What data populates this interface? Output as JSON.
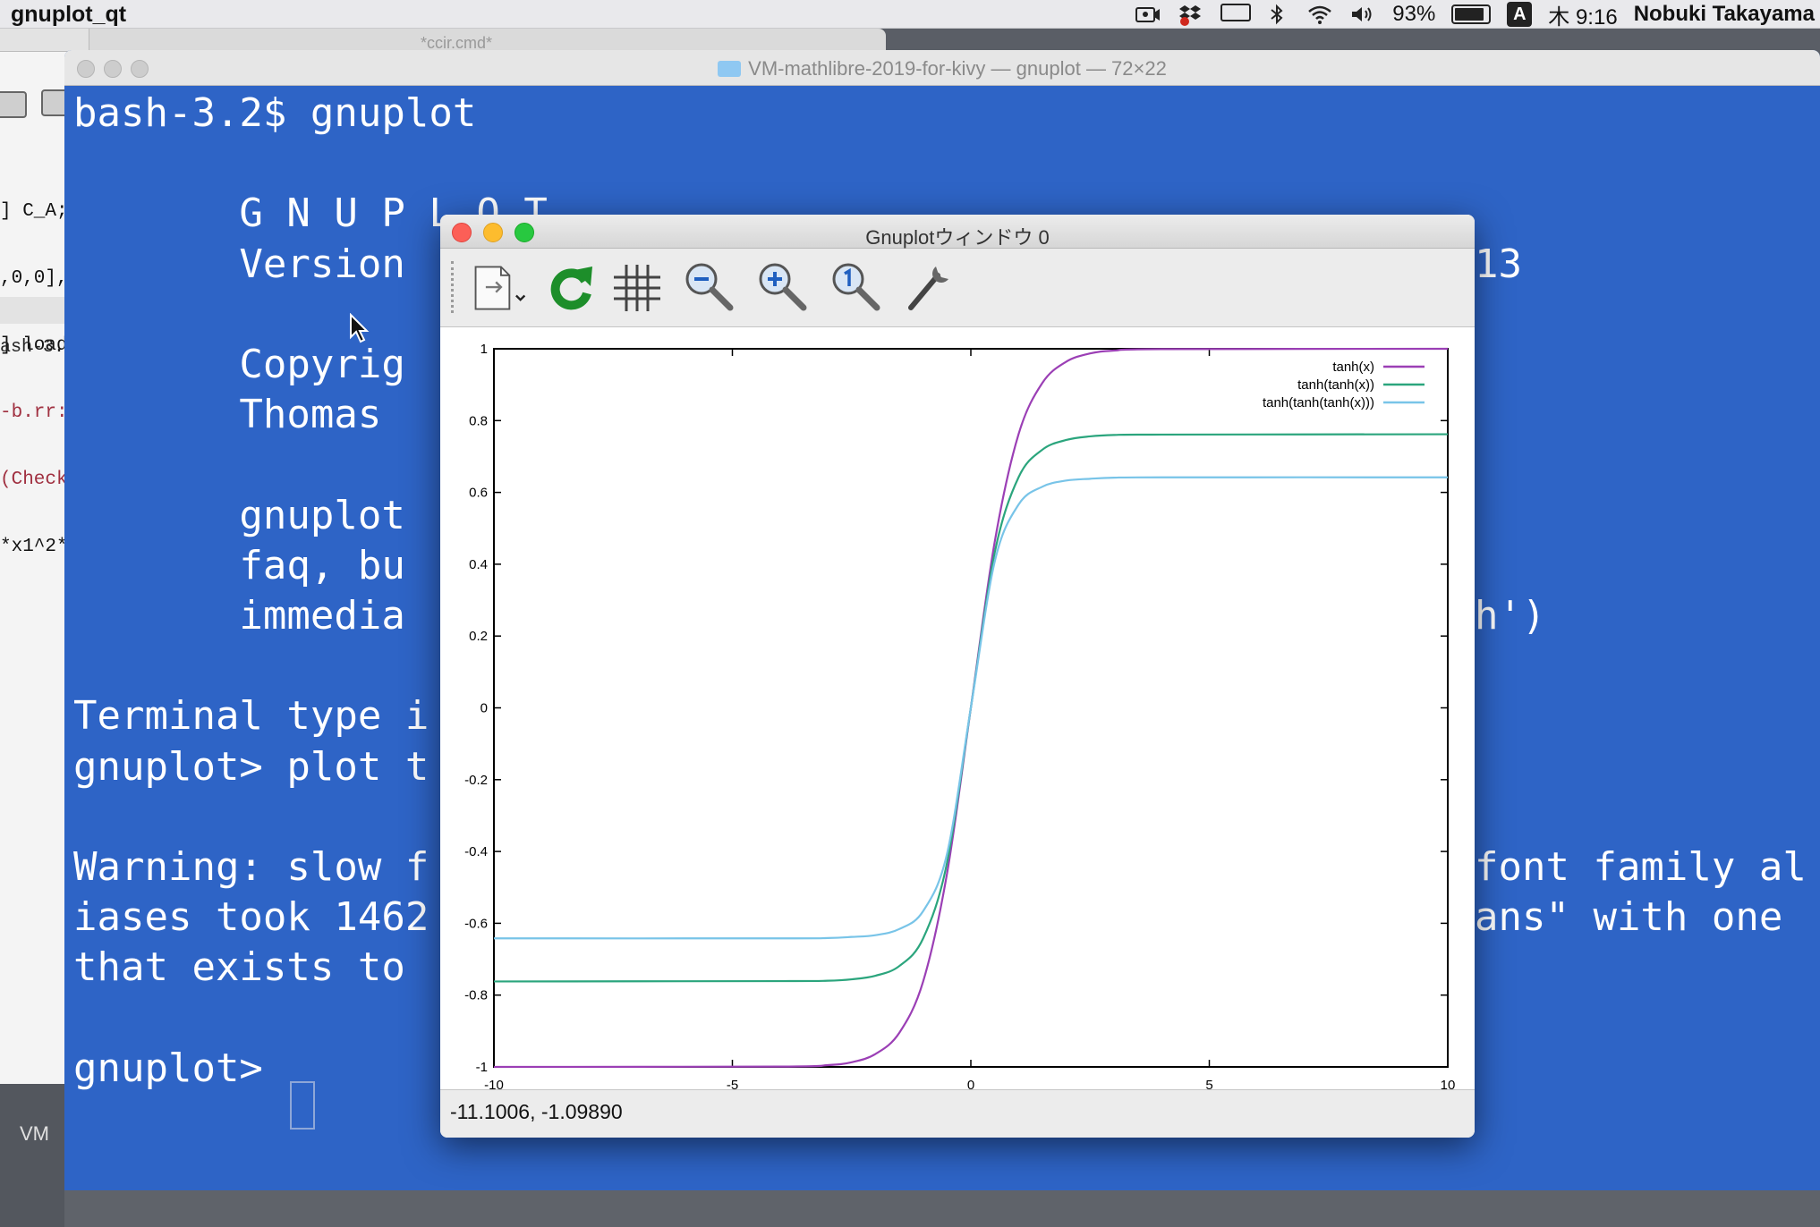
{
  "menubar": {
    "app_name": "gnuplot_qt",
    "battery": "93%",
    "input_source": "A",
    "clock": "木 9:16",
    "user": "Nobuki Takayama"
  },
  "background_window": {
    "title": "*ccir.cmd*",
    "code_lines": [
      "] C_A;",
      ",0,0],",
      "] load",
      "-b.rr:",
      "(Check",
      "*x1^2*"
    ],
    "prompt": "ash-3.",
    "vm_label": "VM"
  },
  "terminal": {
    "title": "VM-mathlibre-2019-for-kivy — gnuplot — 72×22",
    "lines": [
      "bash-3.2$ gnuplot",
      "",
      "       G N U P L O T",
      "       Version",
      "",
      "       Copyrig",
      "       Thomas",
      "",
      "       gnuplot",
      "       faq, bu",
      "       immedia",
      "",
      "Terminal type i",
      "gnuplot> plot t",
      "",
      "Warning: slow f",
      "iases took 1462",
      "that exists to",
      "",
      "gnuplot> "
    ],
    "right_fragments": [
      {
        "text": "13",
        "line": 3
      },
      {
        "text": "h')",
        "line": 10
      },
      {
        "text": "font family al",
        "line": 15
      },
      {
        "text": "ans\" with one",
        "line": 16
      }
    ]
  },
  "gnuplot_window": {
    "title": "Gnuplotウィンドウ 0",
    "status_coords": "-11.1006, -1.09890",
    "toolbar": [
      {
        "name": "export-menu-icon"
      },
      {
        "name": "replot-icon"
      },
      {
        "name": "grid-icon"
      },
      {
        "name": "zoom-out-icon"
      },
      {
        "name": "zoom-in-icon"
      },
      {
        "name": "zoom-reset-icon"
      },
      {
        "name": "settings-wrench-icon"
      }
    ]
  },
  "chart_data": {
    "type": "line",
    "title": "",
    "xlabel": "",
    "ylabel": "",
    "xlim": [
      -10,
      10
    ],
    "ylim": [
      -1,
      1
    ],
    "xticks": [
      "-10",
      "-5",
      "0",
      "5",
      "10"
    ],
    "yticks": [
      "-1",
      "-0.8",
      "-0.6",
      "-0.4",
      "-0.2",
      "0",
      "0.2",
      "0.4",
      "0.6",
      "0.8",
      "1"
    ],
    "xtick_values": [
      -10,
      -5,
      0,
      5,
      10
    ],
    "ytick_values": [
      -1,
      -0.8,
      -0.6,
      -0.4,
      -0.2,
      0,
      0.2,
      0.4,
      0.6,
      0.8,
      1
    ],
    "grid": false,
    "legend_position": "top-right",
    "series": [
      {
        "name": "tanh(x)",
        "color": "#9b3fb5",
        "x": [
          -10,
          -4,
          -3,
          -2.5,
          -2,
          -1.5,
          -1,
          -0.5,
          0,
          0.5,
          1,
          1.5,
          2,
          2.5,
          3,
          4,
          10
        ],
        "y": [
          -1,
          -0.999,
          -0.995,
          -0.987,
          -0.964,
          -0.905,
          -0.762,
          -0.462,
          0,
          0.462,
          0.762,
          0.905,
          0.964,
          0.987,
          0.995,
          0.999,
          1
        ]
      },
      {
        "name": "tanh(tanh(x))",
        "color": "#2ba57d",
        "x": [
          -10,
          -4,
          -3,
          -2.5,
          -2,
          -1.5,
          -1,
          -0.5,
          0,
          0.5,
          1,
          1.5,
          2,
          2.5,
          3,
          4,
          10
        ],
        "y": [
          -0.762,
          -0.761,
          -0.76,
          -0.756,
          -0.746,
          -0.719,
          -0.642,
          -0.432,
          0,
          0.432,
          0.642,
          0.719,
          0.746,
          0.756,
          0.76,
          0.761,
          0.762
        ]
      },
      {
        "name": "tanh(tanh(tanh(x)))",
        "color": "#78c4e8",
        "x": [
          -10,
          -4,
          -3,
          -2.5,
          -2,
          -1.5,
          -1,
          -0.5,
          0,
          0.5,
          1,
          1.5,
          2,
          2.5,
          3,
          4,
          10
        ],
        "y": [
          -0.642,
          -0.642,
          -0.641,
          -0.638,
          -0.633,
          -0.616,
          -0.566,
          -0.407,
          0,
          0.407,
          0.566,
          0.616,
          0.633,
          0.638,
          0.641,
          0.642,
          0.642
        ]
      }
    ]
  }
}
